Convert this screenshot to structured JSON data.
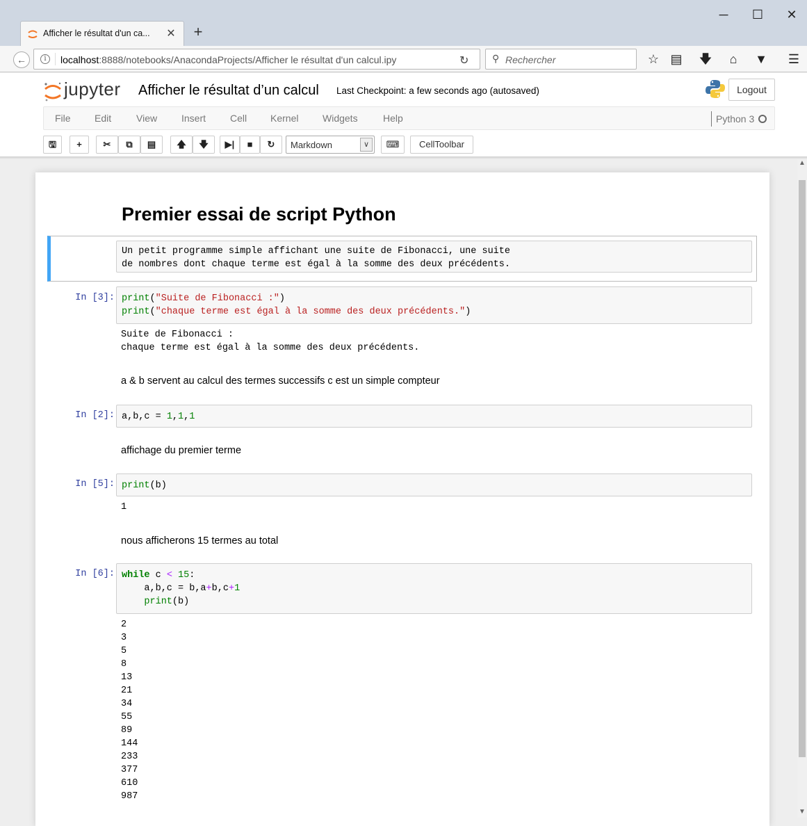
{
  "browser": {
    "tab_title": "Afficher le résultat d'un ca...",
    "tab_close": "✕",
    "new_tab": "+",
    "window_controls": {
      "minimize": "─",
      "maximize": "☐",
      "close": "✕"
    },
    "url_host": "localhost",
    "url_rest": ":8888/notebooks/AnacondaProjects/Afficher le résultat d'un calcul.ipy",
    "search_placeholder": "Rechercher",
    "toolbar_icons": [
      "star-icon",
      "reading-list-icon",
      "download-icon",
      "home-icon",
      "pocket-icon",
      "menu-icon"
    ]
  },
  "jupyter": {
    "logo_text": "jupyter",
    "notebook_title": "Afficher le résultat d’un calcul",
    "checkpoint": "Last Checkpoint: a few seconds ago (autosaved)",
    "logout_label": "Logout",
    "menu": [
      "File",
      "Edit",
      "View",
      "Insert",
      "Cell",
      "Kernel",
      "Widgets",
      "Help"
    ],
    "kernel_name": "Python 3",
    "cell_type": "Markdown",
    "celltoolbar_label": "CellToolbar",
    "toolbar_icons": [
      "save-icon",
      "add-cell-icon",
      "cut-icon",
      "copy-icon",
      "paste-icon",
      "move-up-icon",
      "move-down-icon",
      "run-icon",
      "stop-icon",
      "restart-icon",
      "keyboard-icon"
    ]
  },
  "notebook": {
    "heading": "Premier essai de script Python",
    "selected_cell_lines": [
      "Un petit programme simple affichant une suite de Fibonacci, une suite",
      "de nombres dont chaque terme est égal à la somme des deux précédents."
    ],
    "cell1": {
      "prompt": "In [3]:",
      "output": "Suite de Fibonacci :\nchaque terme est égal à la somme des deux précédents."
    },
    "md2": "a & b servent au calcul des termes successifs c est un simple compteur",
    "cell2": {
      "prompt": "In [2]:"
    },
    "md3": "affichage du premier terme",
    "cell3": {
      "prompt": "In [5]:",
      "output": "1"
    },
    "md4": "nous afficherons 15 termes au total",
    "cell4": {
      "prompt": "In [6]:",
      "output": "2\n3\n5\n8\n13\n21\n34\n55\n89\n144\n233\n377\n610\n987"
    }
  },
  "colors": {
    "selected_cell_accent": "#42a5f5",
    "prompt_color": "#303f9f",
    "keyword_green": "#008000",
    "string_red": "#ba2121",
    "operator_purple": "#aa22ff"
  }
}
